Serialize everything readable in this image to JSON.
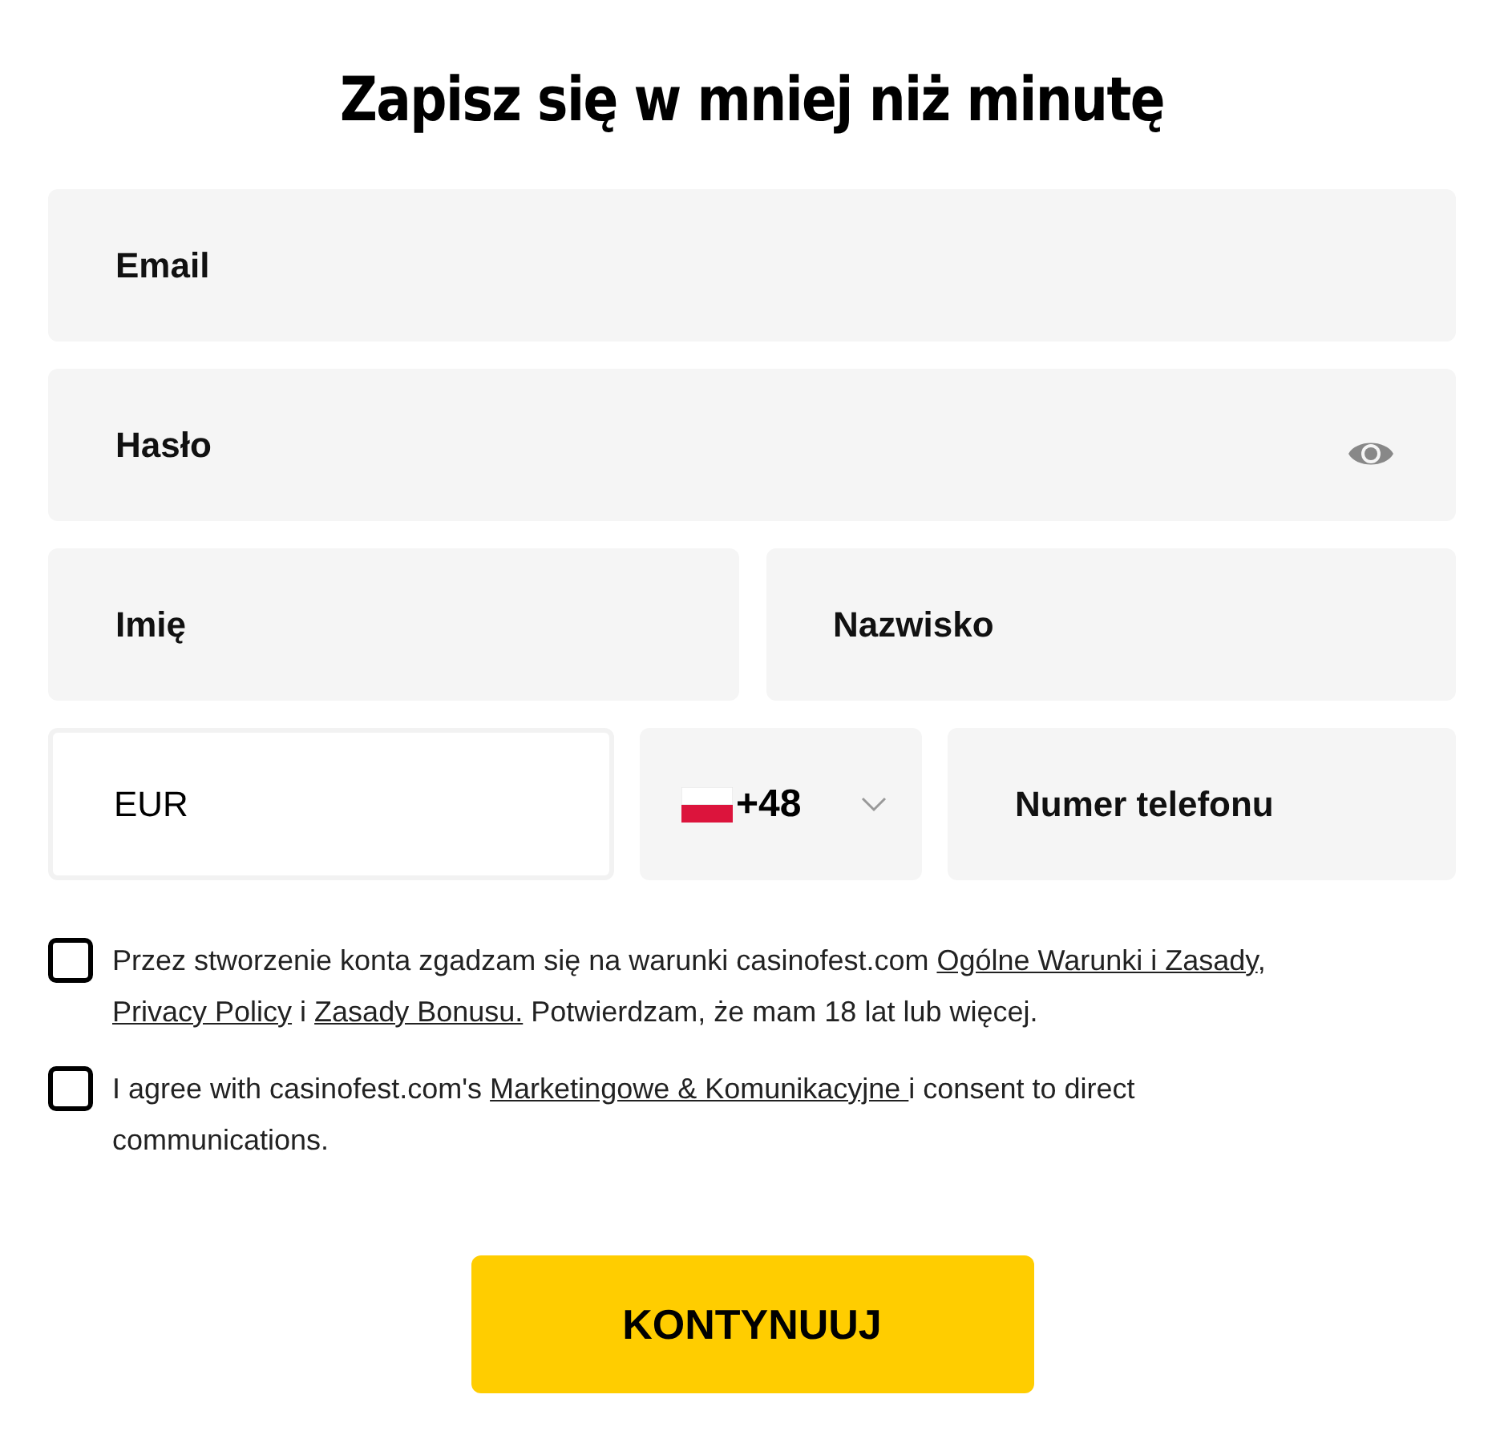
{
  "title": "Zapisz się w mniej niż minutę",
  "fields": {
    "email": {
      "placeholder": "Email"
    },
    "password": {
      "placeholder": "Hasło"
    },
    "first_name": {
      "placeholder": "Imię"
    },
    "last_name": {
      "placeholder": "Nazwisko"
    },
    "currency": {
      "value": "EUR"
    },
    "phone_code": {
      "value": "+48"
    },
    "phone": {
      "placeholder": "Numer telefonu"
    }
  },
  "consents": [
    {
      "checked": false,
      "parts": [
        {
          "kind": "text",
          "text": "Przez stworzenie konta zgadzam się na warunki casinofest.com "
        },
        {
          "kind": "link",
          "text": "Ogólne Warunki i Zasady"
        },
        {
          "kind": "text",
          "text": ", "
        },
        {
          "kind": "link",
          "text": "Privacy Policy"
        },
        {
          "kind": "text",
          "text": " i "
        },
        {
          "kind": "link",
          "text": "Zasady Bonusu."
        },
        {
          "kind": "text",
          "text": " Potwierdzam, że mam 18 lat lub więcej."
        }
      ]
    },
    {
      "checked": false,
      "parts": [
        {
          "kind": "text",
          "text": "I agree with casinofest.com's "
        },
        {
          "kind": "link",
          "text": "Marketingowe & Komunikacyjne "
        },
        {
          "kind": "text",
          "text": "i consent to direct communications."
        }
      ]
    }
  ],
  "submit": "KONTYNUUJ"
}
